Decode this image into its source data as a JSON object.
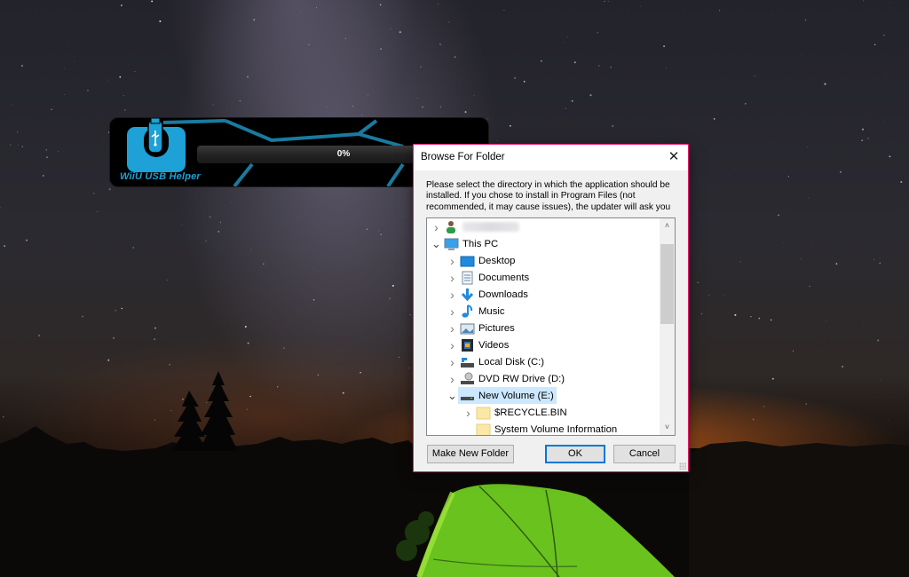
{
  "desktop": {
    "wallpaper": "night-sky-milky-way-tent"
  },
  "splash": {
    "app_name": "WiiU USB Helper",
    "progress_percent": 0,
    "progress_text": "0%",
    "accent_color": "#1da1d6"
  },
  "dialog": {
    "title": "Browse For Folder",
    "close_icon": "close-icon",
    "description": "Please select the directory in which the application should be installed. If you chose to install in Program Files (not recommended, it may cause issues), the updater will ask you",
    "tree": [
      {
        "label": "",
        "icon": "user-icon",
        "expander": "collapsed",
        "level": 0,
        "blurred": true
      },
      {
        "label": "This PC",
        "icon": "this-pc-icon",
        "expander": "expanded",
        "level": 0
      },
      {
        "label": "Desktop",
        "icon": "desktop-icon",
        "expander": "collapsed",
        "level": 1
      },
      {
        "label": "Documents",
        "icon": "documents-icon",
        "expander": "collapsed",
        "level": 1
      },
      {
        "label": "Downloads",
        "icon": "downloads-icon",
        "expander": "collapsed",
        "level": 1
      },
      {
        "label": "Music",
        "icon": "music-icon",
        "expander": "collapsed",
        "level": 1
      },
      {
        "label": "Pictures",
        "icon": "pictures-icon",
        "expander": "collapsed",
        "level": 1
      },
      {
        "label": "Videos",
        "icon": "videos-icon",
        "expander": "collapsed",
        "level": 1
      },
      {
        "label": "Local Disk (C:)",
        "icon": "local-disk-icon",
        "expander": "collapsed",
        "level": 1
      },
      {
        "label": "DVD RW Drive (D:)",
        "icon": "dvd-drive-icon",
        "expander": "collapsed",
        "level": 1
      },
      {
        "label": "New Volume (E:)",
        "icon": "drive-icon",
        "expander": "expanded",
        "level": 1,
        "selected": true
      },
      {
        "label": "$RECYCLE.BIN",
        "icon": "folder-icon",
        "expander": "collapsed",
        "level": 2
      },
      {
        "label": "System Volume Information",
        "icon": "folder-icon",
        "expander": "none",
        "level": 2
      }
    ],
    "buttons": {
      "make_new_folder": "Make New Folder",
      "ok": "OK",
      "cancel": "Cancel"
    },
    "border_color": "#e4186a",
    "selection_color": "#cce8ff"
  }
}
